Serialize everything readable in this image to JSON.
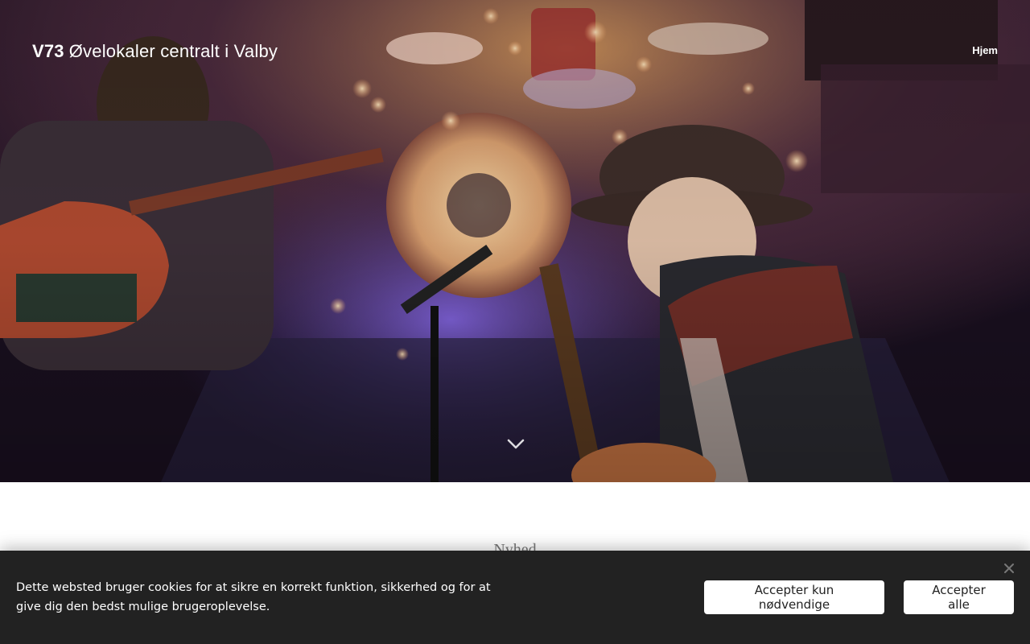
{
  "header": {
    "brand_bold": "V73",
    "brand_light": "Øvelokaler centralt i Valby",
    "nav_home": "Hjem"
  },
  "hero": {
    "image": "concert-stage-photo",
    "scroll_icon": "chevron-down-icon"
  },
  "section": {
    "heading": "Nyhed"
  },
  "cookie_banner": {
    "text": "Dette websted bruger cookies for at sikre en korrekt funktion, sikkerhed og for at give dig den bedst mulige brugeroplevelse.",
    "accept_necessary_label": "Accepter kun nødvendige",
    "accept_all_label": "Accepter alle",
    "close_icon": "close-icon"
  },
  "colors": {
    "banner_bg": "#222222",
    "button_bg": "#ffffff",
    "text_light": "#ffffff"
  }
}
